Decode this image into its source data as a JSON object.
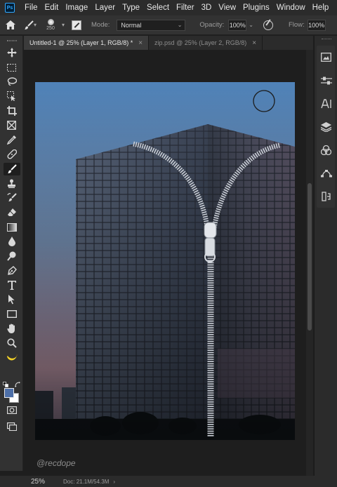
{
  "menubar": {
    "logo": "Ps",
    "items": [
      "File",
      "Edit",
      "Image",
      "Layer",
      "Type",
      "Select",
      "Filter",
      "3D",
      "View",
      "Plugins",
      "Window",
      "Help"
    ]
  },
  "options": {
    "brush_size": "250",
    "mode_label": "Mode:",
    "mode_value": "Normal",
    "opacity_label": "Opacity:",
    "opacity_value": "100%",
    "flow_label": "Flow:",
    "flow_value": "100%"
  },
  "tabs": [
    {
      "label": "Untitled-1 @ 25% (Layer 1, RGB/8) *",
      "active": true
    },
    {
      "label": "zip.psd @ 25% (Layer 2, RGB/8)",
      "active": false
    }
  ],
  "canvas": {
    "watermark": "@recdope"
  },
  "tools": [
    "move-tool",
    "marquee-tool",
    "lasso-tool",
    "object-select-tool",
    "crop-tool",
    "frame-tool",
    "eyedropper-tool",
    "healing-brush-tool",
    "brush-tool",
    "clone-stamp-tool",
    "history-brush-tool",
    "eraser-tool",
    "gradient-tool",
    "blur-tool",
    "dodge-tool",
    "pen-tool",
    "type-tool",
    "path-select-tool",
    "rectangle-tool",
    "hand-tool",
    "zoom-tool",
    "banana-icon"
  ],
  "colors": {
    "foreground": "#4d6fa8",
    "background": "#ffffff",
    "accent": "#31a8ff"
  },
  "statusbar": {
    "zoom": "25%",
    "doc_info": "Doc: 21.1M/54.3M"
  }
}
